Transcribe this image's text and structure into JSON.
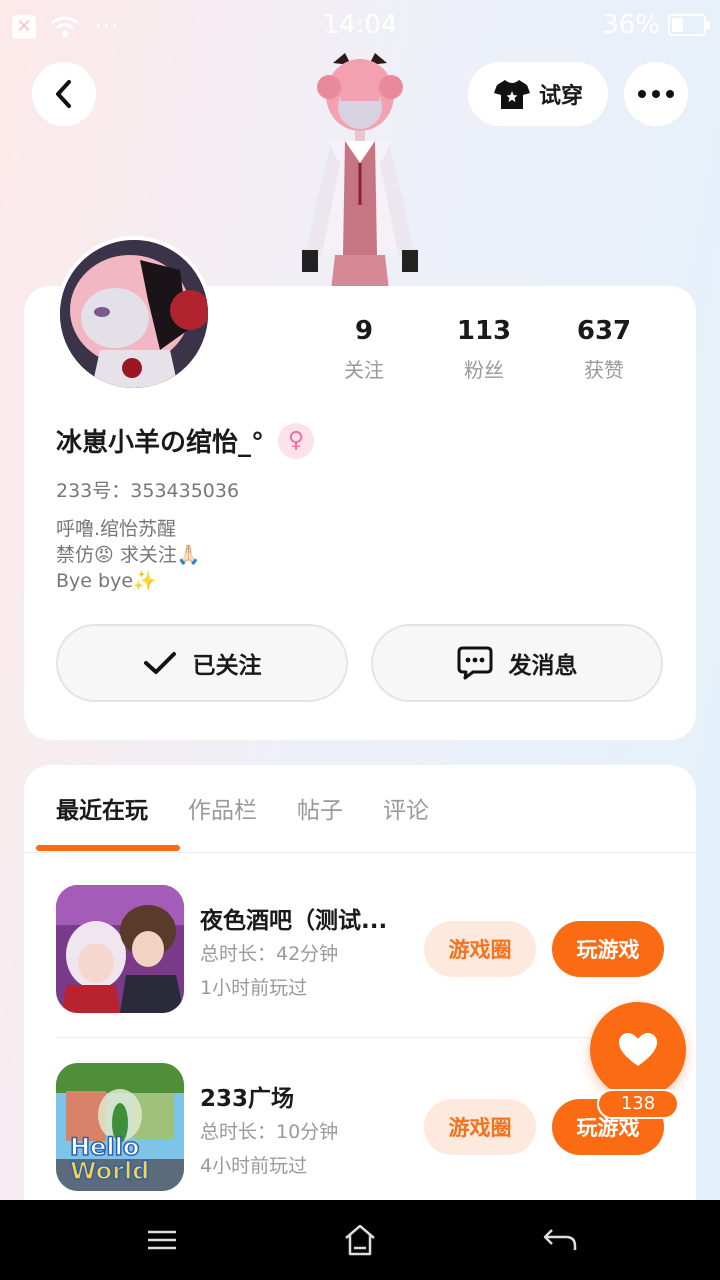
{
  "status_bar": {
    "time": "14:04",
    "battery": "36%",
    "battery_level": 0.36,
    "signal_dots": "···"
  },
  "header": {
    "try_on_label": "试穿"
  },
  "stats": [
    {
      "value": "9",
      "label": "关注"
    },
    {
      "value": "113",
      "label": "粉丝"
    },
    {
      "value": "637",
      "label": "获赞"
    }
  ],
  "profile": {
    "nickname": "冰崽小羊の绾怡_°",
    "gender_symbol": "♀",
    "id_text": "233号：353435036",
    "bio_lines": [
      "呼噜.绾怡苏醒",
      "禁仿😡 求关注🙏🏻",
      "Bye bye✨"
    ]
  },
  "actions": {
    "follow_label": "已关注",
    "message_label": "发消息"
  },
  "tabs": [
    "最近在玩",
    "作品栏",
    "帖子",
    "评论"
  ],
  "games": [
    {
      "title": "夜色酒吧（测试...",
      "duration": "总时长：42分钟",
      "last_played": "1小时前玩过",
      "circle_label": "游戏圈",
      "play_label": "玩游戏"
    },
    {
      "title": "233广场",
      "duration": "总时长：10分钟",
      "last_played": "4小时前玩过",
      "circle_label": "游戏圈",
      "play_label": "玩游戏",
      "icon_text_1": "Hello",
      "icon_text_2": "World"
    }
  ],
  "like_fab": {
    "count": "138"
  },
  "colors": {
    "accent": "#fa6b14",
    "accent_light": "#fde9de",
    "gender": "#ee6ea0"
  }
}
